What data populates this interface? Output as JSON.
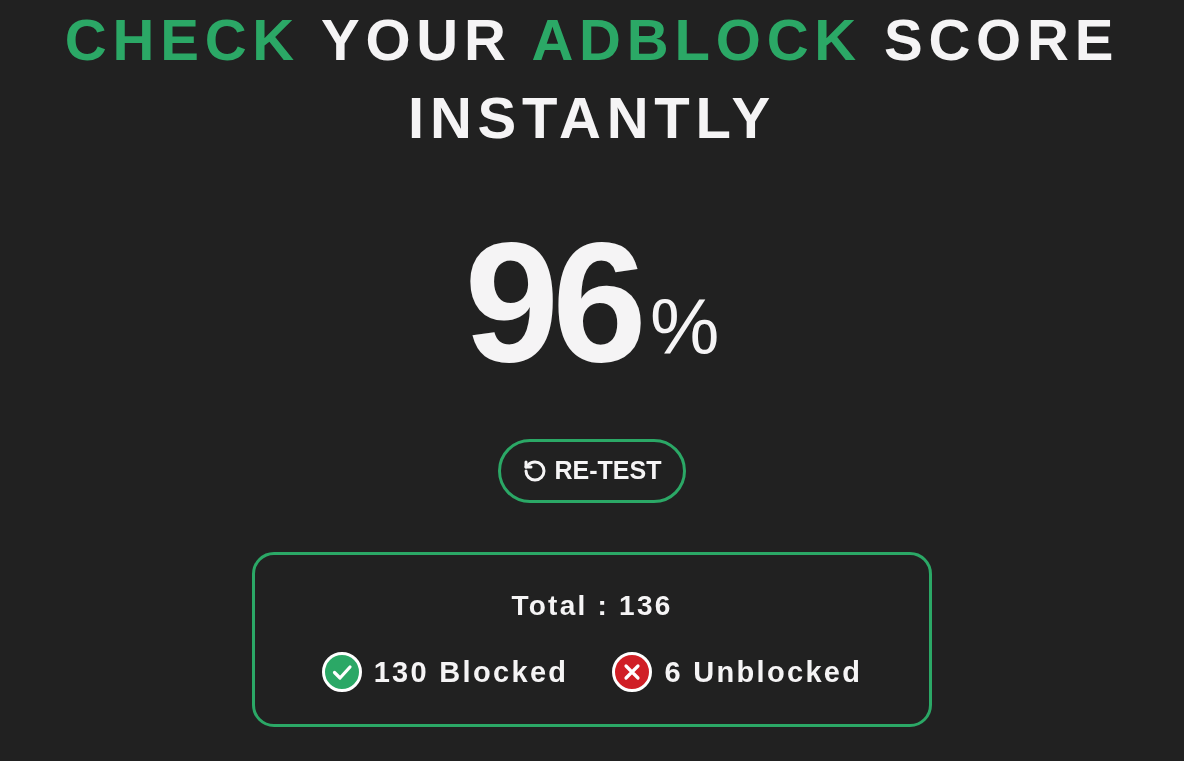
{
  "heading": {
    "lines": [
      {
        "words": [
          {
            "text": "CHECK",
            "color": "#2ba866"
          },
          {
            "text": "YOUR",
            "color": "#f5f4f5"
          },
          {
            "text": "ADBLOCK",
            "color": "#2ba866"
          },
          {
            "text": "SCORE",
            "color": "#f5f4f5"
          }
        ]
      },
      {
        "words": [
          {
            "text": "INSTANTLY",
            "color": "#f5f4f5"
          }
        ]
      }
    ]
  },
  "score": {
    "value": "96",
    "unit": "%"
  },
  "retest_button": {
    "label": "RE-TEST"
  },
  "summary": {
    "total": "Total : 136",
    "items": [
      {
        "kind": "blocked",
        "text": "130 Blocked"
      },
      {
        "kind": "unblocked",
        "text": "6 Unblocked"
      }
    ]
  }
}
